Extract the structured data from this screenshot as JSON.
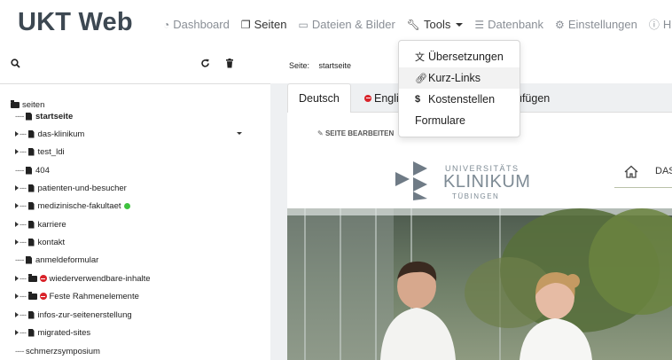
{
  "app": {
    "brand": "UKT Web"
  },
  "nav": {
    "items": [
      {
        "label": "Dashboard",
        "icon": "dashboard-icon"
      },
      {
        "label": "Seiten",
        "icon": "file-icon"
      },
      {
        "label": "Dateien & Bilder",
        "icon": "folder-icon"
      },
      {
        "label": "Tools",
        "icon": "wrench-icon"
      },
      {
        "label": "Datenbank",
        "icon": "database-icon"
      },
      {
        "label": "Einstellungen",
        "icon": "gear-icon"
      },
      {
        "label": "Hilfe",
        "icon": "info-icon"
      }
    ]
  },
  "tools_menu": {
    "items": [
      {
        "label": "Übersetzungen",
        "icon": "translate-icon"
      },
      {
        "label": "Kurz-Links",
        "icon": "link-icon"
      },
      {
        "label": "Kostenstellen",
        "icon": "dollar-icon"
      },
      {
        "label": "Formulare",
        "icon": ""
      }
    ]
  },
  "tree": {
    "root": "seiten",
    "nodes": [
      {
        "label": "startseite",
        "bold": true,
        "expandable": false
      },
      {
        "label": "das-klinikum",
        "expandable": true
      },
      {
        "label": "test_ldi",
        "expandable": true
      },
      {
        "label": "404",
        "expandable": false
      },
      {
        "label": "patienten-und-besucher",
        "expandable": true
      },
      {
        "label": "medizinische-fakultaet",
        "expandable": true,
        "status": "green"
      },
      {
        "label": "karriere",
        "expandable": true
      },
      {
        "label": "kontakt",
        "expandable": true
      },
      {
        "label": "anmeldeformular",
        "expandable": false
      },
      {
        "label": "wiederverwendbare-inhalte",
        "expandable": true,
        "folder": true,
        "blocked": true
      },
      {
        "label": "Feste Rahmenelemente",
        "expandable": true,
        "folder": true,
        "blocked": true
      },
      {
        "label": "infos-zur-seitenerstellung",
        "expandable": true
      },
      {
        "label": "migrated-sites",
        "expandable": true
      },
      {
        "label": "schmerzsymposium",
        "expandable": false,
        "nopage": true
      }
    ]
  },
  "main": {
    "crumb_label": "Seite:",
    "crumb_value": "startseite",
    "tabs": [
      {
        "label": "Deutsch",
        "active": true
      },
      {
        "label": "Engli",
        "active": false,
        "blocked": true
      },
      {
        "label": "üfügen",
        "active": false
      }
    ],
    "edit_button": "SEITE BEARBEITEN",
    "logo": {
      "line1": "UNIVERSITÄTS",
      "line2": "KLINIKUM",
      "line3": "TÜBINGEN"
    },
    "site_nav": "DAS"
  },
  "colors": {
    "brand_text": "#3d4852",
    "nav_muted": "#8a8f96",
    "blocked": "#d9232a",
    "status_green": "#3fc23f",
    "panel_bg": "#eef0f2"
  }
}
